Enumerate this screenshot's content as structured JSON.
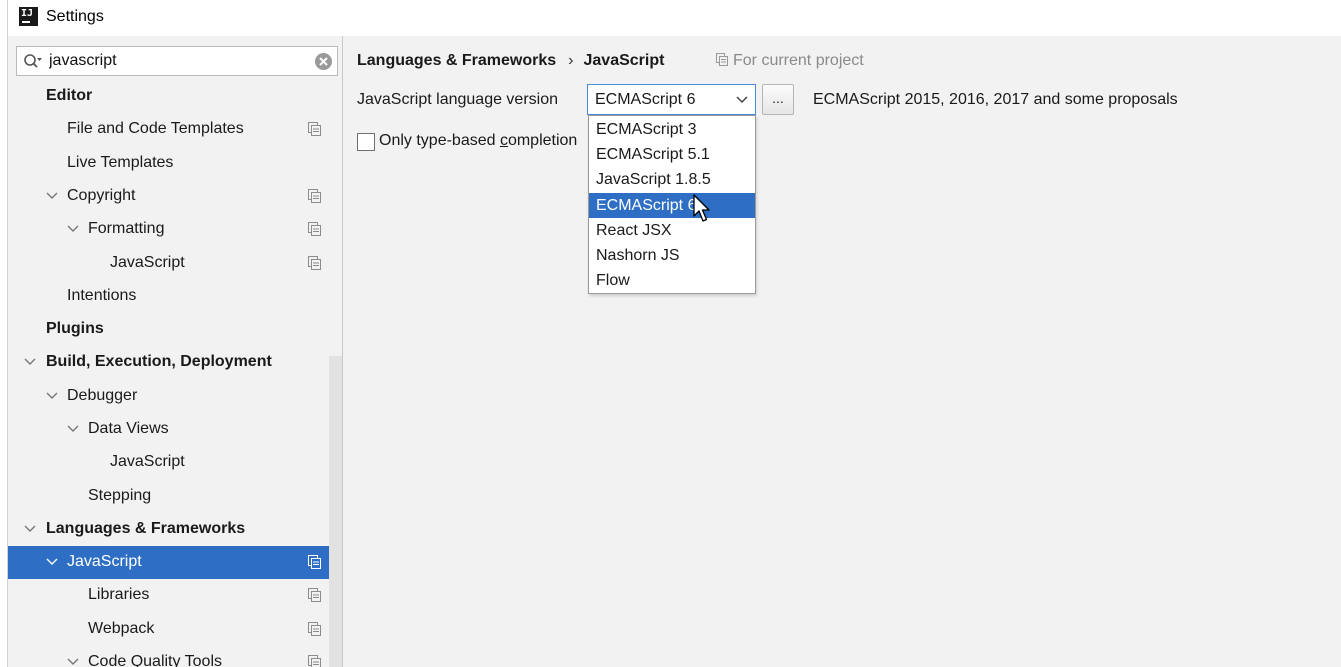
{
  "window": {
    "title": "Settings"
  },
  "search": {
    "value": "javascript"
  },
  "tree": [
    {
      "label": "Editor",
      "bold": true,
      "level": 0,
      "expanded": null,
      "copy": false,
      "selected": false
    },
    {
      "label": "File and Code Templates",
      "bold": false,
      "level": 1,
      "expanded": null,
      "copy": true,
      "selected": false
    },
    {
      "label": "Live Templates",
      "bold": false,
      "level": 1,
      "expanded": null,
      "copy": false,
      "selected": false
    },
    {
      "label": "Copyright",
      "bold": false,
      "level": 1,
      "expanded": true,
      "copy": true,
      "selected": false
    },
    {
      "label": "Formatting",
      "bold": false,
      "level": 2,
      "expanded": true,
      "copy": true,
      "selected": false
    },
    {
      "label": "JavaScript",
      "bold": false,
      "level": 3,
      "expanded": null,
      "copy": true,
      "selected": false
    },
    {
      "label": "Intentions",
      "bold": false,
      "level": 1,
      "expanded": null,
      "copy": false,
      "selected": false
    },
    {
      "label": "Plugins",
      "bold": true,
      "level": 0,
      "expanded": null,
      "copy": false,
      "selected": false
    },
    {
      "label": "Build, Execution, Deployment",
      "bold": true,
      "level": 0,
      "expanded": true,
      "copy": false,
      "selected": false
    },
    {
      "label": "Debugger",
      "bold": false,
      "level": 1,
      "expanded": true,
      "copy": false,
      "selected": false
    },
    {
      "label": "Data Views",
      "bold": false,
      "level": 2,
      "expanded": true,
      "copy": false,
      "selected": false
    },
    {
      "label": "JavaScript",
      "bold": false,
      "level": 3,
      "expanded": null,
      "copy": false,
      "selected": false
    },
    {
      "label": "Stepping",
      "bold": false,
      "level": 2,
      "expanded": null,
      "copy": false,
      "selected": false
    },
    {
      "label": "Languages & Frameworks",
      "bold": true,
      "level": 0,
      "expanded": true,
      "copy": false,
      "selected": false
    },
    {
      "label": "JavaScript",
      "bold": false,
      "level": 1,
      "expanded": true,
      "copy": true,
      "selected": true
    },
    {
      "label": "Libraries",
      "bold": false,
      "level": 2,
      "expanded": null,
      "copy": true,
      "selected": false
    },
    {
      "label": "Webpack",
      "bold": false,
      "level": 2,
      "expanded": null,
      "copy": true,
      "selected": false
    },
    {
      "label": "Code Quality Tools",
      "bold": false,
      "level": 2,
      "expanded": true,
      "copy": true,
      "selected": false
    }
  ],
  "breadcrumb": {
    "parent": "Languages & Frameworks",
    "separator": "›",
    "current": "JavaScript"
  },
  "scope_note": "For current project",
  "language": {
    "label": "JavaScript language version",
    "selected": "ECMAScript 6",
    "more_label": "...",
    "description": "ECMAScript 2015, 2016, 2017 and some proposals",
    "options": [
      "ECMAScript 3",
      "ECMAScript 5.1",
      "JavaScript 1.8.5",
      "ECMAScript 6",
      "React JSX",
      "Nashorn JS",
      "Flow"
    ],
    "highlighted_index": 3
  },
  "completion": {
    "label_before": "Only type-based ",
    "label_underlined": "c",
    "label_after": "ompletion",
    "checked": false
  },
  "colors": {
    "selection": "#2e6fc5",
    "panel": "#f2f2f2",
    "focus_border": "#4a88d9",
    "muted_text": "#8a8a8a"
  }
}
